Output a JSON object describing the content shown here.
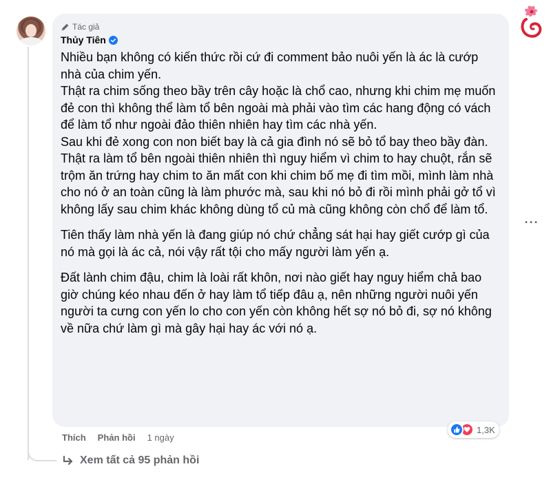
{
  "comment": {
    "author_badge": "Tác giả",
    "author_name": "Thủy Tiên",
    "paragraphs": [
      "Nhiều bạn không có kiến thức rồi cứ đi comment bảo nuôi yến là ác là cướp nhà của chim yến.",
      "Thật ra chim sống theo bầy trên cây hoặc là chổ cao, nhưng khi chim mẹ muốn đẻ con thì không thể làm tổ bên ngoài mà phải vào tìm các hang động có vách để làm tổ như ngoài đảo thiên nhiên hay tìm các nhà yến.",
      "Sau khi đẻ xong con non biết bay là cả gia đình nó sẽ bỏ tổ bay theo bầy đàn.",
      "Thật ra làm tổ bên ngoài thiên nhiên thì nguy hiểm vì chim to hay chuột, rắn sẽ trộm ăn trứng hay chim to ăn mất con khi chim bố mẹ đi tìm mồi, mình làm nhà cho nó ở an toàn cũng là làm phước mà, sau khi nó bỏ đi rồi mình phải gở tổ vì không lấy sau chim khác không dùng tổ củ mà cũng không còn chổ để làm tổ.",
      "Tiên thấy làm nhà yến là đang giúp nó chứ chẳng sát hại hay giết cướp gì của nó mà gọi là ác cả, nói vậy rất tội cho mấy người làm yến ạ.",
      "Đất lành chim đậu, chim là loài rất khôn, nơi nào giết hay nguy hiểm chả bao giờ chúng kéo nhau đến ở hay làm tổ tiếp đâu ạ, nên những người nuôi yến người ta cưng con yến lo cho con yến còn không hết sợ nó bỏ đi, sợ nó không về nữa chứ làm gì mà gây hại hay ác với nó ạ."
    ],
    "more_options": "···",
    "actions": {
      "like": "Thích",
      "reply": "Phản hồi",
      "time": "1 ngày"
    },
    "reactions": {
      "count": "1,3K",
      "types": [
        "like-icon",
        "love-icon"
      ]
    },
    "view_replies": "Xem tất cả 95 phản hồi"
  },
  "colors": {
    "bubble_bg": "#f0f2f5",
    "text": "#050505",
    "secondary_text": "#65676b",
    "verified_blue": "#1877f2",
    "like_blue": "#1877f2",
    "love_red": "#f33e58",
    "logo_red": "#d9223a",
    "logo_pink": "#f07a9a"
  }
}
